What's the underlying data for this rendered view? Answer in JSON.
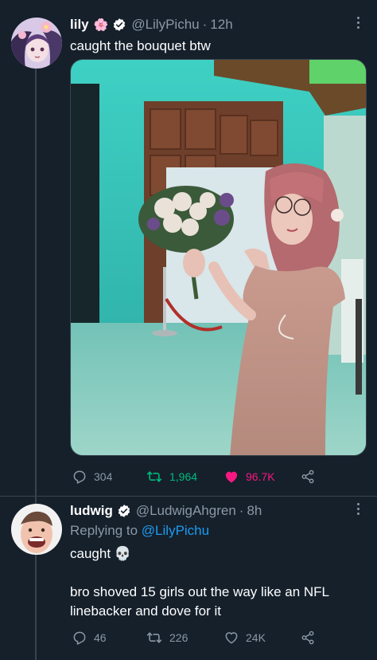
{
  "tweets": [
    {
      "name": "lily",
      "name_emoji": "🌸",
      "handle": "@LilyPichu",
      "time": "12h",
      "text": "caught the bouquet btw",
      "stats": {
        "replies": "304",
        "retweets": "1,964",
        "likes": "96.7K"
      },
      "liked": true,
      "retweet_color": "#00ba7c",
      "like_color": "#f91880"
    },
    {
      "name": "ludwig",
      "handle": "@LudwigAhgren",
      "time": "8h",
      "replying_prefix": "Replying to",
      "replying_to": "@LilyPichu",
      "line1": "caught",
      "line1_emoji": "💀",
      "line2": "bro shoved 15 girls out the way like an NFL",
      "line3": "linebacker and dove for it",
      "stats": {
        "replies": "46",
        "retweets": "226",
        "likes": "24K"
      }
    }
  ],
  "icons": [
    "verified-icon",
    "more-icon",
    "reply-icon",
    "retweet-icon",
    "like-icon",
    "share-icon",
    "skull-emoji"
  ],
  "colors": {
    "background": "#15202b",
    "secondary_text": "#8b98a5",
    "accent": "#1d9bf0"
  }
}
